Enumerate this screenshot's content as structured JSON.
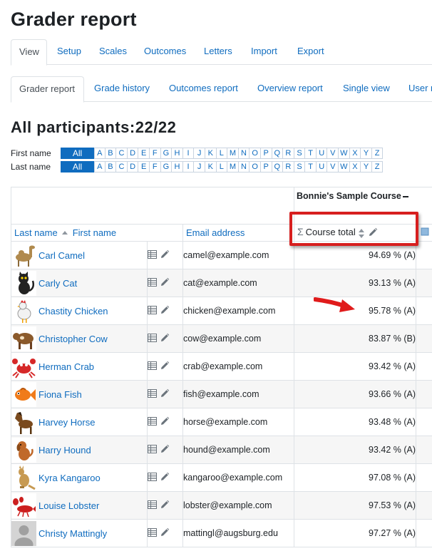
{
  "page": {
    "title": "Grader report"
  },
  "tabs_primary": [
    {
      "label": "View",
      "active": true
    },
    {
      "label": "Setup"
    },
    {
      "label": "Scales"
    },
    {
      "label": "Outcomes"
    },
    {
      "label": "Letters"
    },
    {
      "label": "Import"
    },
    {
      "label": "Export"
    }
  ],
  "tabs_secondary": [
    {
      "label": "Grader report",
      "active": true
    },
    {
      "label": "Grade history"
    },
    {
      "label": "Outcomes report"
    },
    {
      "label": "Overview report"
    },
    {
      "label": "Single view"
    },
    {
      "label": "User r"
    }
  ],
  "participants": {
    "heading": "All participants:22/22"
  },
  "initials_filter": {
    "first_label": "First name",
    "last_label": "Last name",
    "all_label": "All",
    "letters": [
      "A",
      "B",
      "C",
      "D",
      "E",
      "F",
      "G",
      "H",
      "I",
      "J",
      "K",
      "L",
      "M",
      "N",
      "O",
      "P",
      "Q",
      "R",
      "S",
      "T",
      "U",
      "V",
      "W",
      "X",
      "Y",
      "Z"
    ]
  },
  "table": {
    "course_name": "Bonnie's Sample Course",
    "sort_last": "Last name",
    "sort_first": "First name",
    "email_header": "Email address",
    "total_header": "Course total",
    "rows": [
      {
        "name": "Carl Camel",
        "email": "camel@example.com",
        "grade": "94.69 % (A)",
        "avatar": "camel"
      },
      {
        "name": "Carly Cat",
        "email": "cat@example.com",
        "grade": "93.13 % (A)",
        "avatar": "cat"
      },
      {
        "name": "Chastity Chicken",
        "email": "chicken@example.com",
        "grade": "95.78 % (A)",
        "avatar": "chicken"
      },
      {
        "name": "Christopher Cow",
        "email": "cow@example.com",
        "grade": "83.87 % (B)",
        "avatar": "cow"
      },
      {
        "name": "Herman Crab",
        "email": "crab@example.com",
        "grade": "93.42 % (A)",
        "avatar": "crab"
      },
      {
        "name": "Fiona Fish",
        "email": "fish@example.com",
        "grade": "93.66 % (A)",
        "avatar": "fish"
      },
      {
        "name": "Harvey Horse",
        "email": "horse@example.com",
        "grade": "93.48 % (A)",
        "avatar": "horse"
      },
      {
        "name": "Harry Hound",
        "email": "hound@example.com",
        "grade": "93.42 % (A)",
        "avatar": "hound"
      },
      {
        "name": "Kyra Kangaroo",
        "email": "kangaroo@example.com",
        "grade": "97.08 % (A)",
        "avatar": "kangaroo"
      },
      {
        "name": "Louise Lobster",
        "email": "lobster@example.com",
        "grade": "97.53 % (A)",
        "avatar": "lobster"
      },
      {
        "name": "Christy Mattingly",
        "email": "mattingl@augsburg.edu",
        "grade": "97.27 % (A)",
        "avatar": "default-user"
      }
    ]
  },
  "colors": {
    "link": "#0f6cbf",
    "highlight": "#d71f1f",
    "active_filter": "#0f6cbf"
  }
}
